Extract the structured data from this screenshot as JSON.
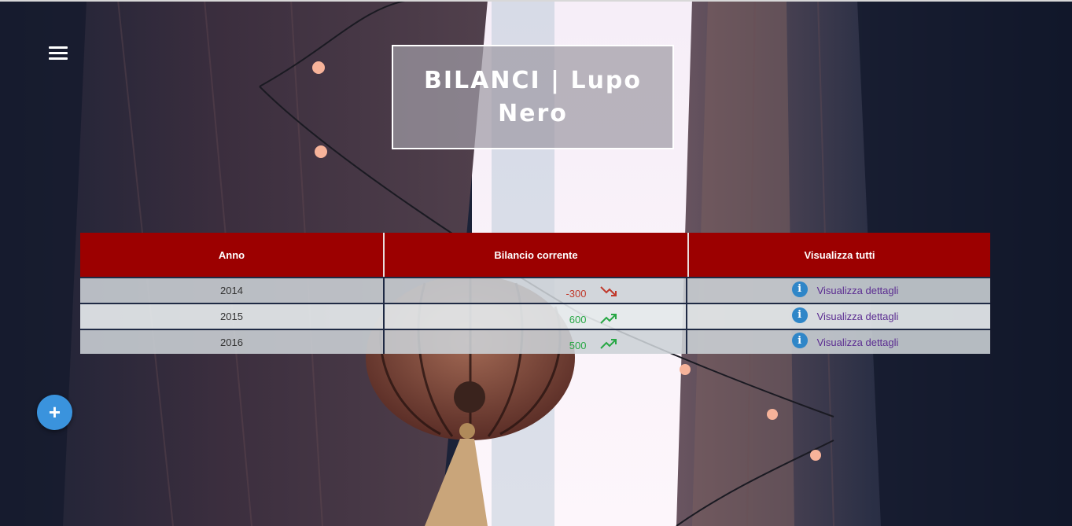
{
  "header": {
    "title": "BILANCI | Lupo Nero"
  },
  "menu": {
    "icon": "hamburger-menu-icon"
  },
  "table": {
    "columns": [
      "Anno",
      "Bilancio corrente",
      "Visualizza tutti"
    ],
    "rows": [
      {
        "year": "2014",
        "balance": "-300",
        "trend": "down",
        "trend_icon": "trending-down-icon",
        "link": "Visualizza dettagli"
      },
      {
        "year": "2015",
        "balance": "600",
        "trend": "up",
        "trend_icon": "trending-up-icon",
        "link": "Visualizza dettagli"
      },
      {
        "year": "2016",
        "balance": "500",
        "trend": "up",
        "trend_icon": "trending-up-icon",
        "link": "Visualizza dettagli"
      }
    ],
    "info_icon_glyph": "i"
  },
  "fab": {
    "label": "+",
    "icon": "add-icon"
  },
  "colors": {
    "header_bg": "#9c0000",
    "negative": "#c0392b",
    "positive": "#27a744",
    "link": "#5b2c91",
    "info": "#2f86c8",
    "fab": "#3a93dd"
  }
}
